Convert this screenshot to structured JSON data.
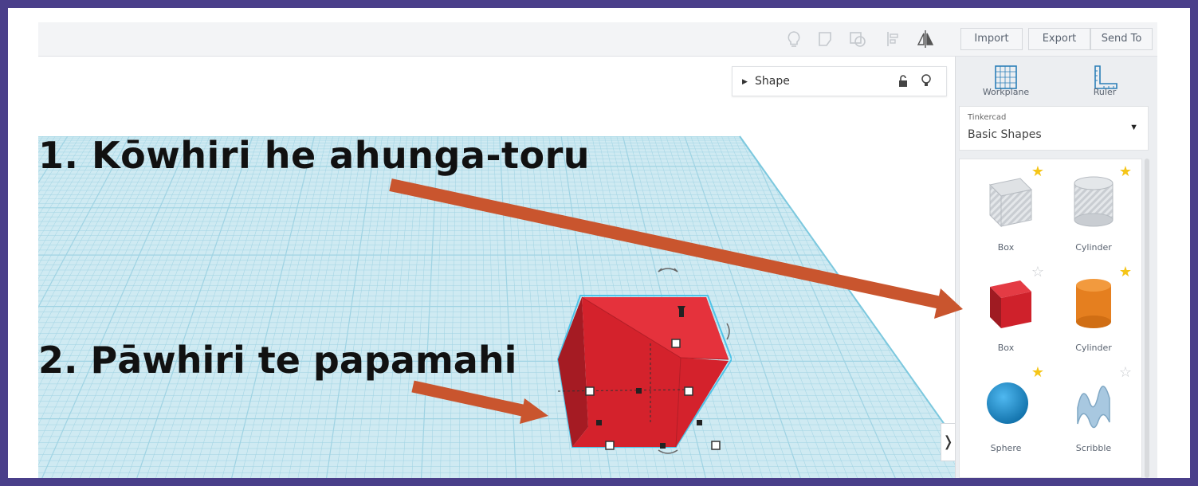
{
  "toolbar": {
    "icons": [
      "lightbulb-icon",
      "group-icon",
      "ungroup-icon",
      "align-icon",
      "mirror-icon"
    ],
    "import_label": "Import",
    "export_label": "Export",
    "send_to_label": "Send To"
  },
  "shape_panel": {
    "title": "Shape",
    "icons": [
      "lock-icon",
      "lightbulb-icon"
    ]
  },
  "sidebar": {
    "workplane_label": "Workplane",
    "ruler_label": "Ruler",
    "library": {
      "source": "Tinkercad",
      "selected": "Basic Shapes"
    },
    "shapes": [
      {
        "label": "Box",
        "style": "hole",
        "starred": true
      },
      {
        "label": "Cylinder",
        "style": "hole",
        "starred": true
      },
      {
        "label": "Box",
        "style": "solid-red",
        "starred": false
      },
      {
        "label": "Cylinder",
        "style": "solid-orange",
        "starred": true
      },
      {
        "label": "Sphere",
        "style": "solid-blue",
        "starred": true
      },
      {
        "label": "Scribble",
        "style": "scribble",
        "starred": false
      }
    ]
  },
  "annotations": {
    "step1": "1.   Kōwhiri he ahunga-toru",
    "step2": "2. Pāwhiri te papamahi"
  },
  "colors": {
    "frame": "#4a3f8a",
    "arrow": "#c9552e",
    "grid_fill": "#cfeaf2",
    "grid_line": "#9fd3e3",
    "box_red": "#d9242f",
    "star_gold": "#f5c518",
    "selection_outline": "#4fc3e8"
  }
}
